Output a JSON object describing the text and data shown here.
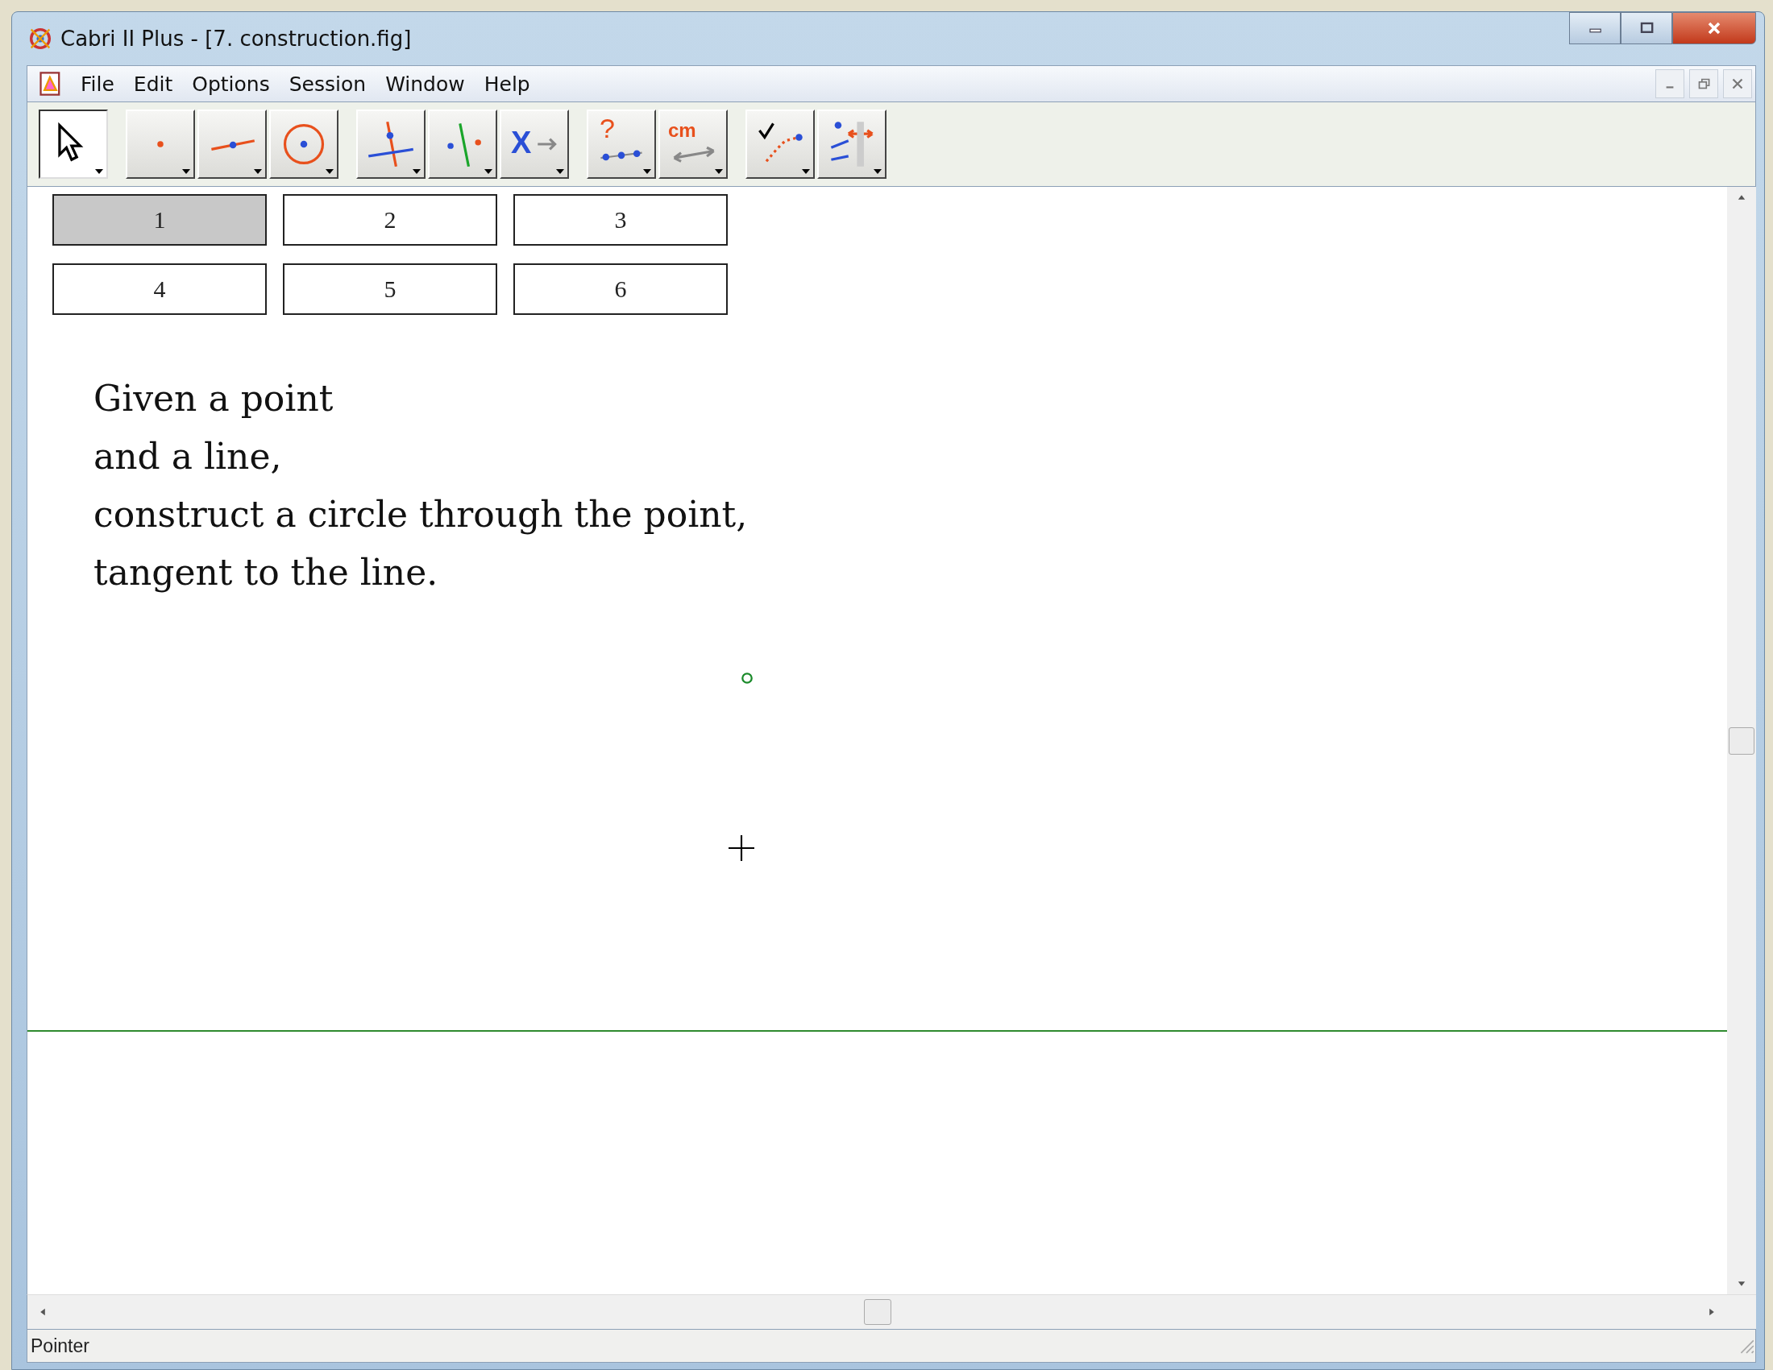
{
  "window": {
    "title": "Cabri II Plus - [7. construction.fig]"
  },
  "menu": [
    "File",
    "Edit",
    "Options",
    "Session",
    "Window",
    "Help"
  ],
  "toolbar": [
    [
      {
        "kind": "pointer",
        "selected": true
      }
    ],
    [
      {
        "kind": "point",
        "selected": false
      },
      {
        "kind": "line",
        "selected": false
      },
      {
        "kind": "circle",
        "selected": false
      }
    ],
    [
      {
        "kind": "perpendicular",
        "selected": false
      },
      {
        "kind": "symmetry",
        "selected": false
      },
      {
        "kind": "map",
        "label": "X",
        "selected": false
      }
    ],
    [
      {
        "kind": "query",
        "label": "?",
        "selected": false
      },
      {
        "kind": "measure",
        "label": "cm",
        "selected": false
      }
    ],
    [
      {
        "kind": "check",
        "selected": false
      },
      {
        "kind": "display",
        "selected": false
      }
    ]
  ],
  "step_buttons": [
    {
      "label": "1",
      "selected": true
    },
    {
      "label": "2",
      "selected": false
    },
    {
      "label": "3",
      "selected": false
    },
    {
      "label": "4",
      "selected": false
    },
    {
      "label": "5",
      "selected": false
    },
    {
      "label": "6",
      "selected": false
    }
  ],
  "instructions": [
    "Given a point",
    "and a line,",
    "construct a circle through the point,",
    "tangent to the line."
  ],
  "status_bar": "Pointer"
}
